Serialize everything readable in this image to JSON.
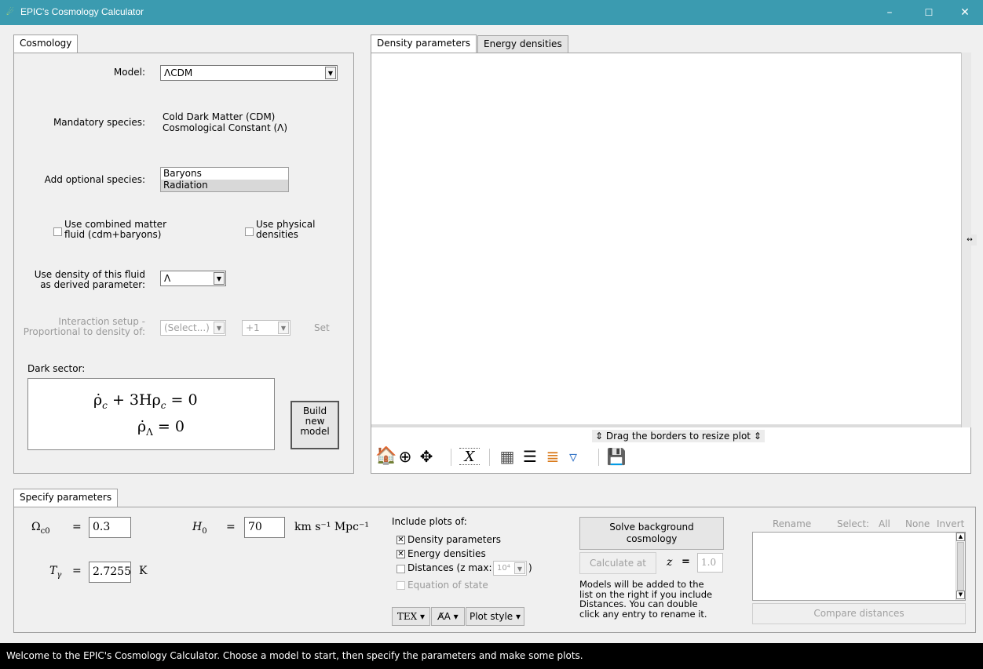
{
  "window": {
    "title": "EPIC's Cosmology Calculator",
    "minimize": "–",
    "maximize": "☐",
    "close": "✕"
  },
  "left_tab": "Cosmology",
  "model": {
    "label": "Model:",
    "value": "ΛCDM"
  },
  "mandatory": {
    "label": "Mandatory species:",
    "line1": "Cold Dark Matter (CDM)",
    "line2": "Cosmological Constant (Λ)"
  },
  "optional": {
    "label": "Add optional species:",
    "items": [
      "Baryons",
      "Radiation"
    ]
  },
  "combined": {
    "line1": "Use combined matter",
    "line2": "fluid (cdm+baryons)"
  },
  "physical": {
    "line1": "Use physical",
    "line2": "densities"
  },
  "derived": {
    "line1": "Use density of this fluid",
    "line2": "as derived parameter:",
    "value": "Λ"
  },
  "interaction": {
    "line1": "Interaction setup -",
    "line2": "Proportional to density of:",
    "select": "(Select...)",
    "sign": "+1",
    "set": "Set"
  },
  "dark_sector": {
    "label": "Dark sector:",
    "eq1_lhs": "ρ̇",
    "eq1_sub": "c",
    "eq1_mid": " + 3Hρ",
    "eq1_sub2": "c",
    "eq1_rhs": " = 0",
    "eq2_lhs": "ρ̇",
    "eq2_sub": "Λ",
    "eq2_rhs": " = 0"
  },
  "build_button": {
    "line1": "Build",
    "line2": "new",
    "line3": "model"
  },
  "plot_tabs": [
    "Density parameters",
    "Energy densities"
  ],
  "drag_hint": "⇕ Drag the borders to resize plot ⇕",
  "resize_handle": "↔",
  "toolbar": {
    "home": "🏠",
    "zoom": "⊕",
    "pan": "✥",
    "xscale": "X",
    "grid": "▦",
    "lines": "☰",
    "legend": "≣",
    "style": "▿",
    "save": "💾"
  },
  "params_tab": "Specify parameters",
  "params": {
    "omega_sym": "Ω",
    "omega_sub": "c0",
    "omega_val": "0.3",
    "h_sym": "H",
    "h_sub": "0",
    "h_val": "70",
    "h_unit": "km s⁻¹ Mpc⁻¹",
    "t_sym": "T",
    "t_sub": "γ",
    "t_val": "2.7255",
    "t_unit": "K",
    "eq": "="
  },
  "plots": {
    "label": "Include plots of:",
    "density": "Density parameters",
    "energy": "Energy densities",
    "distances": "Distances (z max:",
    "zmax": "10⁴",
    "close_paren": ")",
    "eos": "Equation of state"
  },
  "style_buttons": {
    "tex": "TEX",
    "font": "A̸A",
    "plot_style": "Plot style"
  },
  "solve": {
    "line1": "Solve background",
    "line2": "cosmology"
  },
  "calc": {
    "label": "Calculate at",
    "z": "z",
    "eq": "=",
    "value": "1.0"
  },
  "models_note": [
    "Models will be added to the",
    "list on the right if you include",
    "Distances. You can double",
    "click any entry to rename it."
  ],
  "list_controls": {
    "rename": "Rename",
    "select": "Select:",
    "all": "All",
    "none": "None",
    "invert": "Invert"
  },
  "compare": "Compare distances",
  "status": "Welcome to the EPIC's Cosmology Calculator. Choose a model to start, then specify the parameters and make some plots."
}
